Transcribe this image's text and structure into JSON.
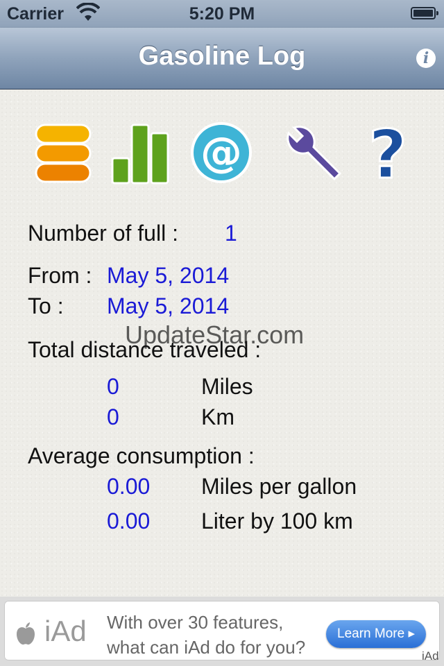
{
  "status_bar": {
    "carrier": "Carrier",
    "time": "5:20 PM"
  },
  "nav": {
    "title": "Gasoline Log",
    "info_icon": "info-icon"
  },
  "toolbar": {
    "icons": [
      "records-stack-icon",
      "bar-chart-icon",
      "email-at-icon",
      "wrench-settings-icon",
      "help-question-icon"
    ]
  },
  "stats": {
    "full_label": "Number of full :",
    "full_value": "1",
    "from_label": "From :",
    "from_value": "May 5, 2014",
    "to_label": "To :",
    "to_value": "May 5, 2014",
    "distance_label": "Total distance traveled :",
    "miles_value": "0",
    "miles_unit": "Miles",
    "km_value": "0",
    "km_unit": "Km",
    "avg_label": "Average consumption :",
    "mpg_value": "0.00",
    "mpg_unit": "Miles per gallon",
    "l100_value": "0.00",
    "l100_unit": "Liter by 100 km"
  },
  "watermark": "UpdateStar.com",
  "ad": {
    "brand": "iAd",
    "line1": "With over 30 features,",
    "line2": "what can iAd do for you?",
    "button": "Learn More",
    "corner": "iAd"
  }
}
